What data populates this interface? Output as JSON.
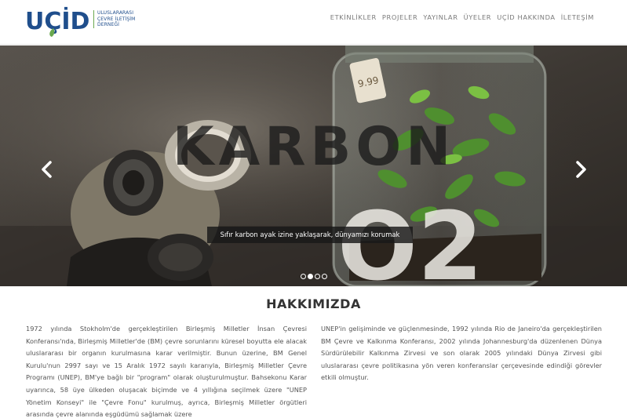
{
  "header": {
    "logo_text": "UÇİD",
    "logo_subtitle": [
      "ULUSLARARASI",
      "ÇEVRE İLETİŞİM",
      "DERNEĞİ"
    ],
    "nav": [
      "ETKİNLİKLER",
      "PROJELER",
      "YAYINLAR",
      "ÜYELER",
      "UÇİD HAKKINDA",
      "İLETEŞİM"
    ]
  },
  "slider": {
    "caption": "Sıfır karbon ayak izine yaklaşarak, dünyamızı korumak",
    "overlay_word": "KARBON",
    "jar_label": "O2",
    "tag_text": "9.99",
    "dots": 4,
    "active_dot": 1,
    "prev_icon": "chevron-left-icon",
    "next_icon": "chevron-right-icon"
  },
  "about": {
    "title": "HAKKIMIZDA",
    "left": "1972 yılında Stokholm'de gerçekleştirilen Birleşmiş Milletler İnsan Çevresi Konferansı'nda, Birleşmiş Milletler'de (BM) çevre sorunlarını küresel boyutta ele alacak uluslararası bir organın kurulmasına karar verilmiştir. Bunun üzerine, BM Genel Kurulu'nun 2997 sayı ve 15 Aralık 1972 sayılı kararıyla, Birleşmiş Milletler Çevre Programı (UNEP), BM'ye bağlı bir \"program\" olarak oluşturulmuştur. Bahsekonu Karar uyarınca, 58 üye ülkeden oluşacak biçimde ve 4 yıllığına seçilmek üzere \"UNEP Yönetim Konseyi\" ile \"Çevre Fonu\" kurulmuş, ayrıca, Birleşmiş Milletler örgütleri arasında çevre alanında eşgüdümü sağlamak üzere",
    "right": "UNEP'in gelişiminde ve güçlenmesinde, 1992 yılında Rio de Janeiro'da gerçekleştirilen BM Çevre ve Kalkınma Konferansı, 2002 yılında Johannesburg'da düzenlenen Dünya Sürdürülebilir Kalkınma Zirvesi ve son olarak 2005 yılındaki Dünya Zirvesi gibi uluslararası çevre politikasına yön veren konferanslar çerçevesinde edindiği görevler etkili olmuştur."
  },
  "colors": {
    "brand_blue": "#1f4e8c",
    "brand_green": "#6aa84f",
    "nav_text": "#7a7a7a"
  }
}
